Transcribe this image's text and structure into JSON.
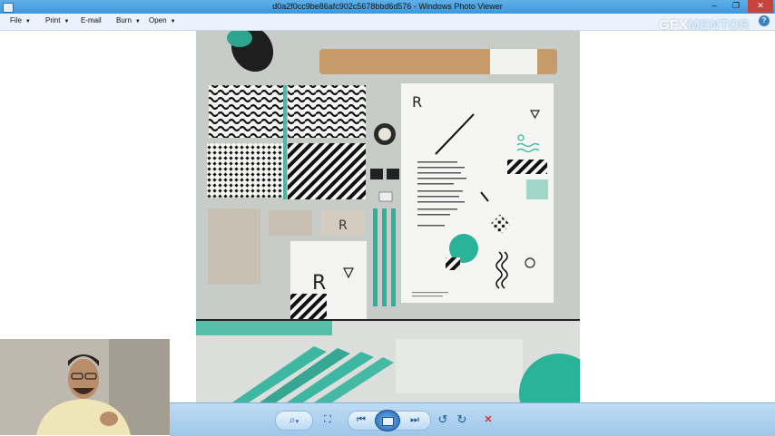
{
  "window": {
    "title": "d0a2f0cc9be86afc902c5678bbd6d576 - Windows Photo Viewer",
    "minimize_label": "–",
    "maximize_label": "❐",
    "close_label": "✕"
  },
  "menubar": {
    "items": [
      {
        "label": "File",
        "has_arrow": true
      },
      {
        "label": "Print",
        "has_arrow": true
      },
      {
        "label": "E-mail",
        "has_arrow": false
      },
      {
        "label": "Burn",
        "has_arrow": true
      },
      {
        "label": "Open",
        "has_arrow": true
      }
    ],
    "arrow_glyph": "▼",
    "help_label": "?"
  },
  "watermark": {
    "text_a": "GFX",
    "text_b": "MENTOR"
  },
  "toolbar": {
    "zoom_icon": "magnifier-icon",
    "fit_icon": "actual-size-icon",
    "previous_icon": "previous-icon",
    "slideshow_icon": "slideshow-icon",
    "next_icon": "next-icon",
    "rotate_ccw_icon": "rotate-counterclockwise-icon",
    "rotate_cw_icon": "rotate-clockwise-icon",
    "delete_icon": "delete-icon",
    "zoom_glyph": "⌕",
    "zoom_arrow": "▾",
    "fit_glyph": "⛶",
    "prev_glyph": "⏮",
    "next_glyph": "⏭",
    "rotate_ccw_glyph": "↺",
    "rotate_cw_glyph": "↻",
    "delete_glyph": "✕"
  },
  "colors": {
    "accent_teal": "#2bb39a",
    "titlebar": "#4aa3e0",
    "statusbar": "#a9cfee",
    "delete_red": "#d0342c"
  }
}
